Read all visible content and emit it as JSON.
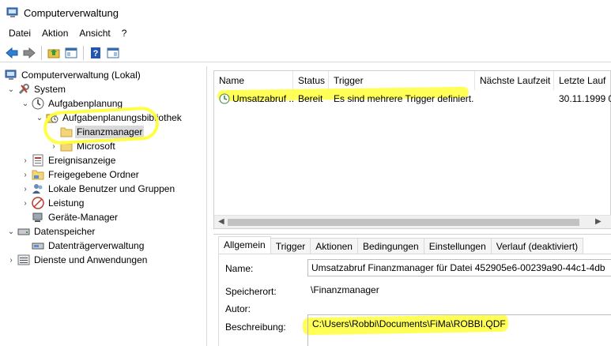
{
  "window": {
    "title": "Computerverwaltung"
  },
  "menu": {
    "items": [
      "Datei",
      "Aktion",
      "Ansicht",
      "?"
    ]
  },
  "toolbar": {
    "buttons": [
      "back-icon",
      "forward-icon",
      "up-folder-icon",
      "show-tree-icon",
      "help-icon",
      "show-action-pane-icon"
    ]
  },
  "tree": {
    "root": "Computerverwaltung (Lokal)",
    "system": "System",
    "aufgabenplanung": "Aufgabenplanung",
    "bibliothek": "Aufgabenplanungsbibliothek",
    "finanzmanager": "Finanzmanager",
    "microsoft": "Microsoft",
    "ereignisanzeige": "Ereignisanzeige",
    "freigaben": "Freigegebene Ordner",
    "benutzer": "Lokale Benutzer und Gruppen",
    "leistung": "Leistung",
    "geraete": "Geräte-Manager",
    "datenspeicher": "Datenspeicher",
    "datentraeger": "Datenträgerverwaltung",
    "dienste": "Dienste und Anwendungen"
  },
  "task_list": {
    "columns": [
      "Name",
      "Status",
      "Trigger",
      "Nächste Laufzeit",
      "Letzte Lauf"
    ],
    "rows": [
      {
        "name": "Umsatzabruf ...",
        "status": "Bereit",
        "trigger": "Es sind mehrere Trigger definiert.",
        "next_run": "",
        "last_run": "30.11.1999 0"
      }
    ]
  },
  "details": {
    "tabs": [
      "Allgemein",
      "Trigger",
      "Aktionen",
      "Bedingungen",
      "Einstellungen",
      "Verlauf (deaktiviert)"
    ],
    "name_label": "Name:",
    "name_value": "Umsatzabruf Finanzmanager für Datei 452905e6-00239a90-44c1-4db",
    "location_label": "Speicherort:",
    "location_value": "\\Finanzmanager",
    "author_label": "Autor:",
    "author_value": "",
    "description_label": "Beschreibung:",
    "description_value": "C:\\Users\\Robbi\\Documents\\FiMa\\ROBBI.QDF"
  },
  "colors": {
    "highlight": "#ffff3a",
    "selection": "#d9d9d9",
    "accent": "#1e73c8"
  }
}
